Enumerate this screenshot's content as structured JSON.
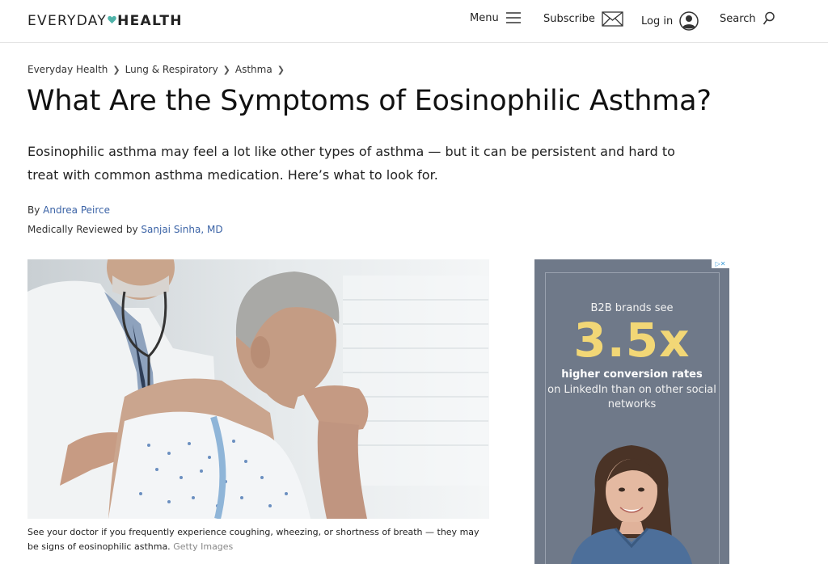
{
  "brand": {
    "logo_light": "EVERYDAY",
    "logo_bold": "HEALTH",
    "heart_color": "#4fb3a9"
  },
  "nav": {
    "menu_label": "Menu",
    "subscribe_label": "Subscribe",
    "login_label": "Log in",
    "search_label": "Search"
  },
  "breadcrumb": [
    "Everyday Health",
    "Lung & Respiratory",
    "Asthma"
  ],
  "article": {
    "title": "What Are the Symptoms of Eosinophilic Asthma?",
    "dek": "Eosinophilic asthma may feel a lot like other types of asthma — but it can be persistent and hard to treat with common asthma medication. Here’s what to look for.",
    "by_prefix": "By",
    "author": "Andrea Peirce",
    "reviewed_prefix": "Medically Reviewed by",
    "reviewer": "Sanjai Sinha, MD",
    "caption": "See your doctor if you frequently experience coughing, wheezing, or shortness of breath — they may be signs of eosinophilic asthma.",
    "image_credit": "Getty Images"
  },
  "ad": {
    "choices": "▷✕",
    "line1": "B2B brands see",
    "big": "3.5x",
    "line2": "higher conversion rates",
    "line3": "on LinkedIn than on other social networks"
  },
  "colors": {
    "link": "#3b63a6",
    "ad_bg": "#6f7989",
    "ad_accent": "#f2d776"
  }
}
